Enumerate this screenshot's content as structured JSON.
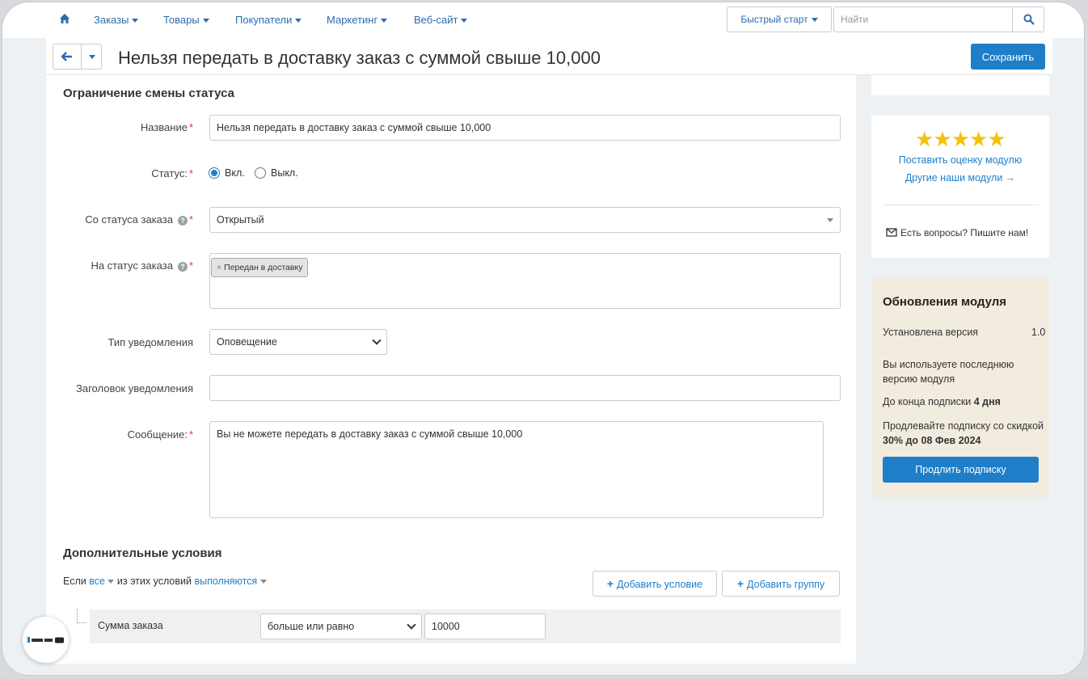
{
  "nav": {
    "items": [
      {
        "label": "Заказы"
      },
      {
        "label": "Товары"
      },
      {
        "label": "Покупатели"
      },
      {
        "label": "Маркетинг"
      },
      {
        "label": "Веб-сайт"
      }
    ],
    "quick_start": "Быстрый старт",
    "search_placeholder": "Найти"
  },
  "header": {
    "title": "Нельзя передать в доставку заказ с суммой свыше 10,000",
    "save_label": "Сохранить"
  },
  "form": {
    "section_title": "Ограничение смены статуса",
    "name_label": "Название",
    "name_value": "Нельзя передать в доставку заказ с суммой свыше 10,000",
    "status_label": "Статус:",
    "status_on": "Вкл.",
    "status_off": "Выкл.",
    "status_selected": "Вкл.",
    "from_status_label": "Со статуса заказа",
    "from_status_value": "Открытый",
    "to_status_label": "На статус заказа",
    "to_status_tag": "Передан в доставку",
    "notify_type_label": "Тип уведомления",
    "notify_type_value": "Оповещение",
    "notify_title_label": "Заголовок уведомления",
    "notify_title_value": "",
    "message_label": "Сообщение:",
    "message_value": "Вы не можете передать в доставку заказ с суммой свыше 10,000"
  },
  "conditions": {
    "section_title": "Дополнительные условия",
    "if_prefix": "Если",
    "all_label": "все",
    "middle_text": "из этих условий",
    "met_label": "выполняются",
    "add_condition": "Добавить условие",
    "add_group": "Добавить группу",
    "row": {
      "field": "Сумма заказа",
      "operator": "больше или равно",
      "value": "10000"
    }
  },
  "sidebar": {
    "rate_module": "Поставить оценку модулю",
    "other_modules": "Другие наши модули →",
    "questions": "Есть вопросы? Пишите нам!",
    "stars": 5,
    "updates": {
      "title": "Обновления модуля",
      "installed_label": "Установлена версия",
      "installed_value": "1.0",
      "latest_text": "Вы используете последнюю версию модуля",
      "sub_prefix": "До конца подписки ",
      "sub_days": "4 дня",
      "renew_text_prefix": "Продлевайте подписку со скидкой ",
      "renew_text_bold": "30% до 08 Фев 2024",
      "renew_button": "Продлить подписку"
    }
  },
  "colors": {
    "accent": "#1e7ec8",
    "star": "#f4c20d",
    "updates_bg": "#f2ece0"
  }
}
